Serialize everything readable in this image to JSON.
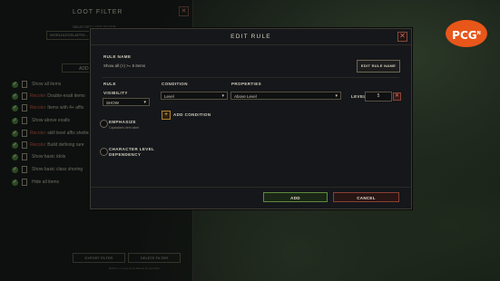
{
  "background_panel": {
    "title": "LOOT FILTER",
    "close": "✕",
    "subtitle": "SELECTED LOOT FILTER",
    "selected_filter": "WORLDLEVELAFFIX...",
    "add_button": "ADD",
    "rules": [
      {
        "red": "",
        "label": "Show all items"
      },
      {
        "red": "Recolor",
        "label": "Double-exalt items"
      },
      {
        "red": "Recolor",
        "label": "Items with 4+ affix"
      },
      {
        "red": "",
        "label": "Show above exalts"
      },
      {
        "red": "Recolor",
        "label": "skill level affix shelter"
      },
      {
        "red": "Recolor",
        "label": "Build defining rare"
      },
      {
        "red": "",
        "label": "Show basic idols"
      },
      {
        "red": "",
        "label": "Show basic class shoring"
      },
      {
        "red": "",
        "label": "Hide all items"
      }
    ],
    "export_button": "EXPORT FILTER",
    "delete_button": "DELETE FILTER",
    "hint": "Build 0.x. A new items filtered by new filter."
  },
  "modal": {
    "title": "EDIT RULE",
    "close": "✕",
    "rule_name_label": "RULE NAME",
    "rule_name_value": "Show all (>) >= 5 items",
    "edit_rule_name_button": "EDIT RULE NAME",
    "rule_label": "RULE",
    "visibility_label": "VISIBILITY",
    "visibility_value": "SHOW",
    "emphasize_label": "EMPHASIZE",
    "emphasize_sub": "Capitalizes item label",
    "character_level_label": "CHARACTER LEVEL",
    "dependency_label": "DEPENDENCY",
    "condition_label": "CONDITION",
    "condition_value": "Level",
    "properties_label": "PROPERTIES",
    "properties_value": "Above Level",
    "level_label": "LEVEL",
    "level_value": "5",
    "remove": "✕",
    "add_condition_icon": "+",
    "add_condition_label": "ADD CONDITION",
    "add_button": "ADD",
    "cancel_button": "CANCEL"
  },
  "logo": {
    "text": "PCG",
    "sup": "N"
  },
  "icons": {
    "caret": "▾",
    "check": "✓"
  },
  "colors": {
    "accent_green": "#5f8a3b",
    "accent_red": "#8a3f33",
    "logo_orange": "#e8561a"
  }
}
